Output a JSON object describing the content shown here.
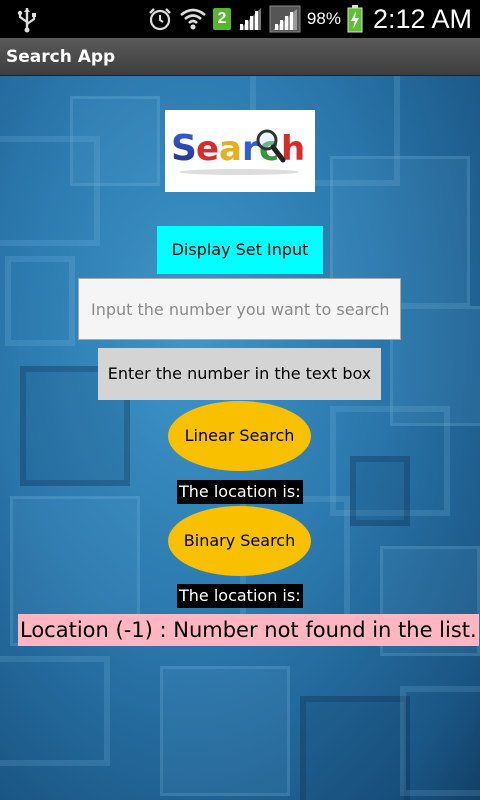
{
  "status_bar": {
    "sim_slot": "2",
    "battery_percent": "98%",
    "time": "2:12 AM",
    "icons": [
      "usb-icon",
      "alarm-clock-icon",
      "wifi-icon",
      "signal-icon",
      "signal-roaming-icon",
      "battery-charging-icon"
    ]
  },
  "app": {
    "title": "Search App"
  },
  "logo": {
    "text": "Search",
    "icon": "magnifying-glass-icon"
  },
  "main": {
    "display_button_label": "Display Set Input",
    "search_input_placeholder": "Input the number you want to search.",
    "search_input_value": "",
    "enter_button_label": "Enter the number in the text box",
    "linear_button_label": "Linear Search",
    "linear_location_label": "The location is:",
    "binary_button_label": "Binary Search",
    "binary_location_label": "The location is:",
    "result_text": "Location (-1) : Number not found in the list."
  },
  "colors": {
    "display_button": "#00ffff",
    "ellipse_buttons": "#f9c000",
    "enter_button": "#d4d4d4",
    "result_background": "#ffb6c1",
    "background": "#2b78ad"
  }
}
